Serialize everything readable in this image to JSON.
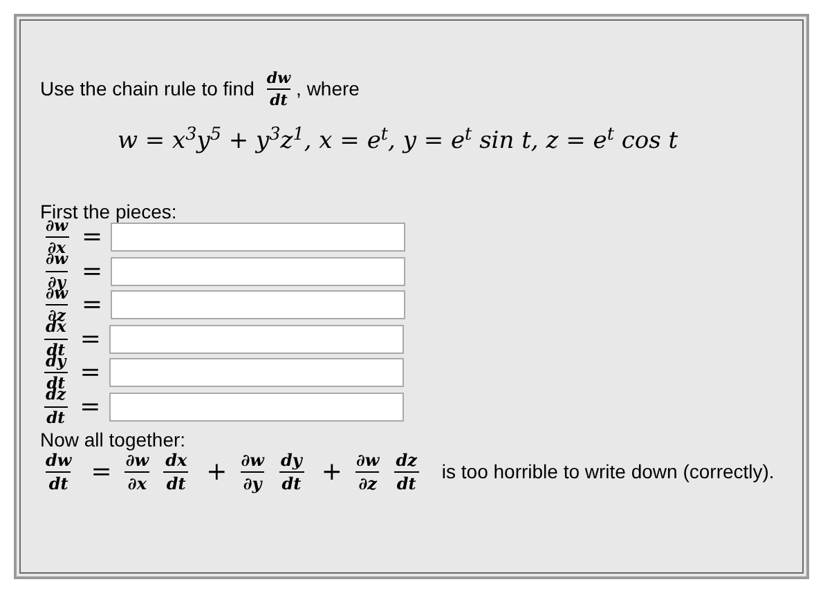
{
  "intro": {
    "before": "Use the chain rule to find",
    "fraction": {
      "num": "dw",
      "den": "dt"
    },
    "after": ", where"
  },
  "equation": "w = x$^{3}$y$^{5}$ + y$^{3}$z$^{1}$, x = e$^{t}$, y = e$^{t}$ sin t, z = e$^{t}$ cos t",
  "pieces_heading": "First the pieces:",
  "pieces": [
    {
      "num": "∂w",
      "den": "∂x",
      "equals": "="
    },
    {
      "num": "∂w",
      "den": "∂y",
      "equals": "="
    },
    {
      "num": "∂w",
      "den": "∂z",
      "equals": "="
    },
    {
      "num": "dx",
      "den": "dt",
      "equals": "="
    },
    {
      "num": "dy",
      "den": "dt",
      "equals": "="
    },
    {
      "num": "dz",
      "den": "dt",
      "equals": "="
    }
  ],
  "together_heading": "Now all together:",
  "formula": [
    {
      "kind": "frac",
      "num": "dw",
      "den": "dt"
    },
    {
      "kind": "op",
      "text": "="
    },
    {
      "kind": "frac",
      "num": "∂w",
      "den": "∂x"
    },
    {
      "kind": "frac",
      "num": "dx",
      "den": "dt"
    },
    {
      "kind": "op",
      "text": "+"
    },
    {
      "kind": "frac",
      "num": "∂w",
      "den": "∂y"
    },
    {
      "kind": "frac",
      "num": "dy",
      "den": "dt"
    },
    {
      "kind": "op",
      "text": "+"
    },
    {
      "kind": "frac",
      "num": "∂w",
      "den": "∂z"
    },
    {
      "kind": "frac",
      "num": "dz",
      "den": "dt"
    }
  ],
  "formula_note": "is too horrible to write down (correctly)."
}
